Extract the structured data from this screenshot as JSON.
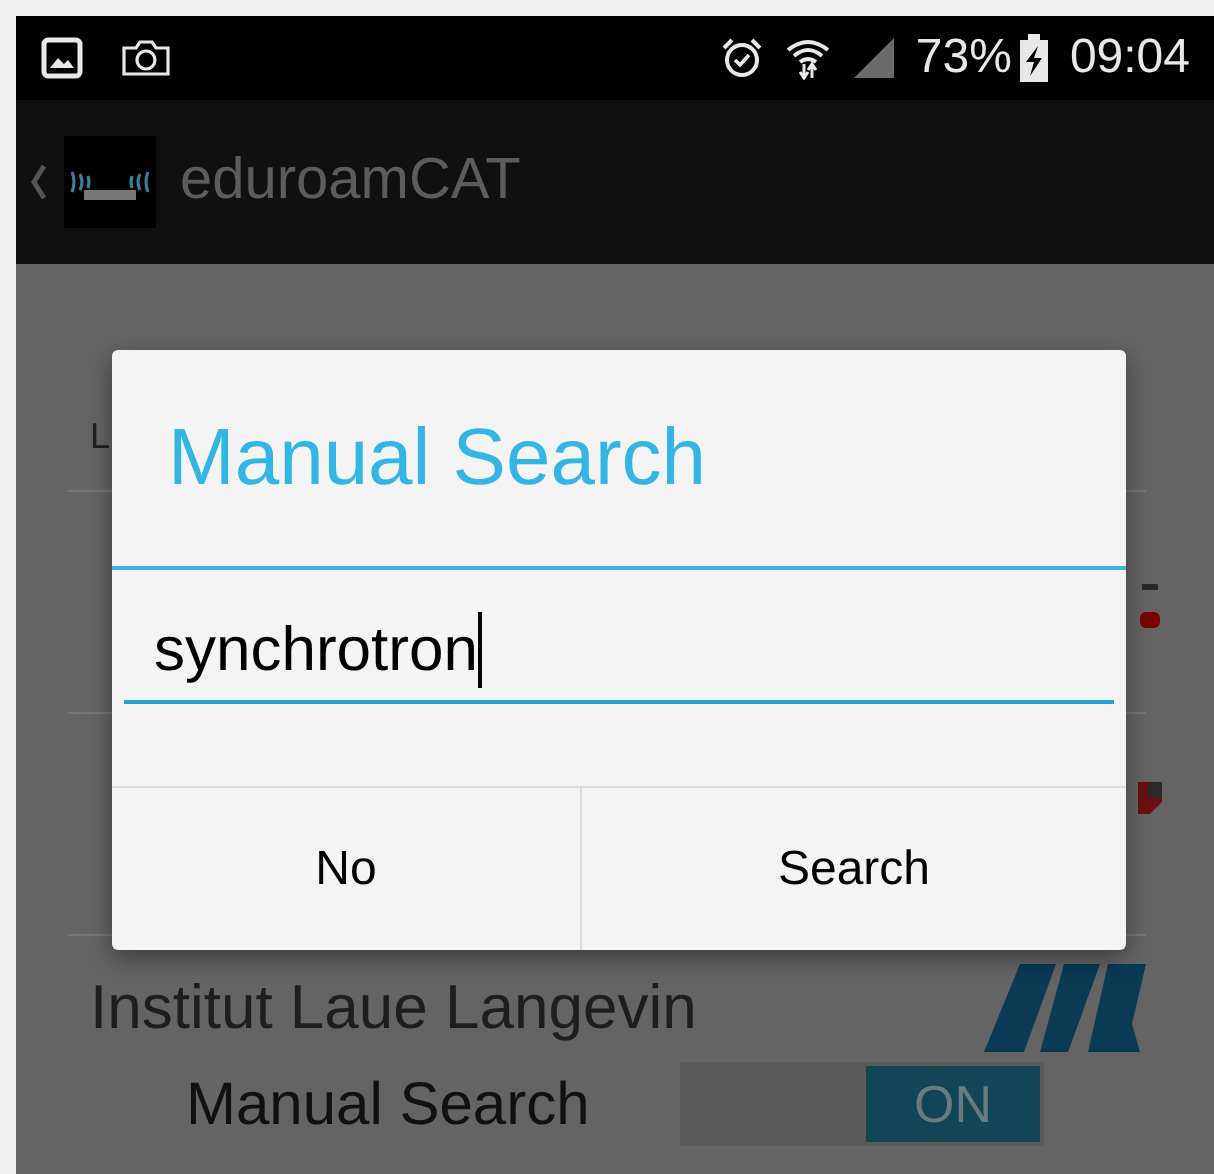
{
  "status_bar": {
    "battery": "73%",
    "time": "09:04"
  },
  "action_bar": {
    "title": "eduroamCAT"
  },
  "background": {
    "header": "L",
    "institution": "Institut Laue Langevin",
    "manual_search": {
      "label": "Manual Search",
      "on": true,
      "toggle_text": "ON"
    }
  },
  "dialog": {
    "title": "Manual Search",
    "value": "synchrotron",
    "buttons": [
      "No",
      "Search"
    ]
  }
}
